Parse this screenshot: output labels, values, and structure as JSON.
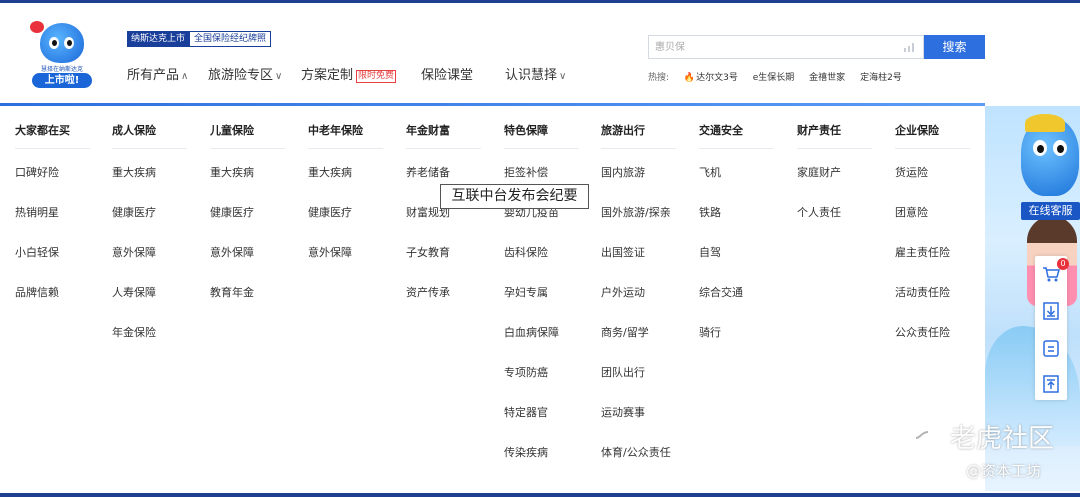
{
  "logo": {
    "small_text": "慧择在纳斯达克",
    "badge_text": "上市啦!"
  },
  "tags": {
    "listed": "纳斯达克上市",
    "license": "全国保险经纪牌照"
  },
  "nav": {
    "items": [
      {
        "label": "所有产品",
        "chevron": "∧"
      },
      {
        "label": "旅游险专区",
        "chevron": "∨"
      },
      {
        "label": "方案定制",
        "tag": "限时免费"
      },
      {
        "label": "保险课堂"
      },
      {
        "label": "认识慧择",
        "chevron": "∨"
      }
    ]
  },
  "search": {
    "placeholder": "惠贝保",
    "button_label": "搜索"
  },
  "hot": {
    "label": "热搜:",
    "items": [
      "达尔文3号",
      "e生保长期",
      "金禧世家",
      "定海柱2号"
    ]
  },
  "menu": {
    "columns": [
      {
        "head": "大家都在买",
        "items": [
          "口碑好险",
          "热销明星",
          "小白轻保",
          "品牌信赖"
        ]
      },
      {
        "head": "成人保险",
        "items": [
          "重大疾病",
          "健康医疗",
          "意外保障",
          "人寿保障",
          "年金保险"
        ]
      },
      {
        "head": "儿童保险",
        "items": [
          "重大疾病",
          "健康医疗",
          "意外保障",
          "教育年金"
        ]
      },
      {
        "head": "中老年保险",
        "items": [
          "重大疾病",
          "健康医疗",
          "意外保障"
        ]
      },
      {
        "head": "年金财富",
        "items": [
          "养老储备",
          "财富规划",
          "子女教育",
          "资产传承"
        ]
      },
      {
        "head": "特色保障",
        "items": [
          "拒签补偿",
          "婴幼儿疫苗",
          "齿科保险",
          "孕妇专属",
          "白血病保障",
          "专项防癌",
          "特定器官",
          "传染疾病"
        ]
      },
      {
        "head": "旅游出行",
        "items": [
          "国内旅游",
          "国外旅游/探亲",
          "出国签证",
          "户外运动",
          "商务/留学",
          "团队出行",
          "运动赛事",
          "体育/公众责任"
        ]
      },
      {
        "head": "交通安全",
        "items": [
          "飞机",
          "铁路",
          "自驾",
          "综合交通",
          "骑行"
        ]
      },
      {
        "head": "财产责任",
        "items": [
          "家庭财产",
          "个人责任"
        ]
      },
      {
        "head": "企业保险",
        "items": [
          "货运险",
          "团意险",
          "雇主责任险",
          "活动责任险",
          "公众责任险"
        ]
      }
    ]
  },
  "tooltip": "互联中台发布会纪要",
  "promo": {
    "service_label": "在线客服"
  },
  "sidebar": {
    "cart_badge": "0",
    "icons": [
      "cart-icon",
      "download-icon",
      "edit-icon",
      "back-to-top-icon"
    ]
  },
  "watermark": {
    "line1": "老虎社区",
    "line2": "@资本工坊"
  },
  "colors": {
    "primary": "#2e6fe0",
    "navy": "#1a3f9a",
    "hot_red": "#e84040"
  }
}
